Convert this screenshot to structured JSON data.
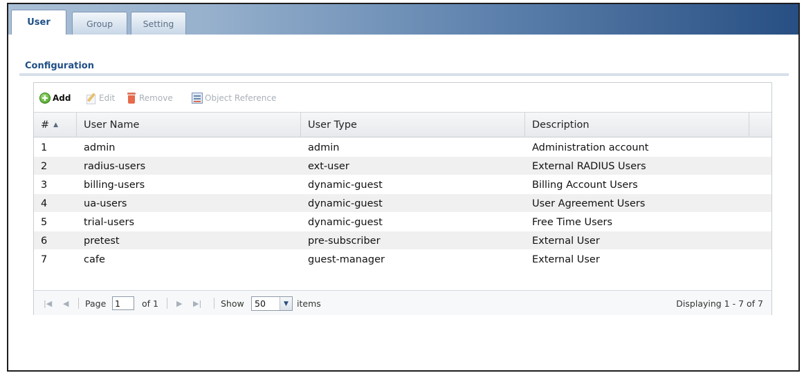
{
  "tabs": [
    {
      "label": "User",
      "active": true
    },
    {
      "label": "Group",
      "active": false
    },
    {
      "label": "Setting",
      "active": false
    }
  ],
  "section": {
    "title": "Configuration"
  },
  "toolbar": {
    "add_label": "Add",
    "edit_label": "Edit",
    "remove_label": "Remove",
    "object_reference_label": "Object Reference"
  },
  "table": {
    "columns": [
      "#",
      "User Name",
      "User Type",
      "Description"
    ],
    "sort_indicator": "▲",
    "rows": [
      {
        "index": "1",
        "user_name": "admin",
        "user_type": "admin",
        "description": "Administration account"
      },
      {
        "index": "2",
        "user_name": "radius-users",
        "user_type": "ext-user",
        "description": "External RADIUS Users"
      },
      {
        "index": "3",
        "user_name": "billing-users",
        "user_type": "dynamic-guest",
        "description": "Billing Account Users"
      },
      {
        "index": "4",
        "user_name": "ua-users",
        "user_type": "dynamic-guest",
        "description": "User Agreement Users"
      },
      {
        "index": "5",
        "user_name": "trial-users",
        "user_type": "dynamic-guest",
        "description": "Free Time Users"
      },
      {
        "index": "6",
        "user_name": "pretest",
        "user_type": "pre-subscriber",
        "description": "External User"
      },
      {
        "index": "7",
        "user_name": "cafe",
        "user_type": "guest-manager",
        "description": "External User"
      }
    ]
  },
  "pager": {
    "page_label": "Page",
    "page_value": "1",
    "of_label": "of 1",
    "show_label": "Show",
    "show_value": "50",
    "items_label": "items",
    "displaying": "Displaying 1 - 7 of 7"
  },
  "colors": {
    "accent": "#1f4f87",
    "tabbar_dark": "#284f83",
    "add_green": "#3e9a1f"
  },
  "icons": {
    "add": "add-circle-icon",
    "edit": "pencil-edit-icon",
    "remove": "trash-icon",
    "object_reference": "object-reference-icon",
    "first": "first-page-icon",
    "prev": "prev-page-icon",
    "next": "next-page-icon",
    "last": "last-page-icon",
    "dropdown": "chevron-down-icon"
  }
}
